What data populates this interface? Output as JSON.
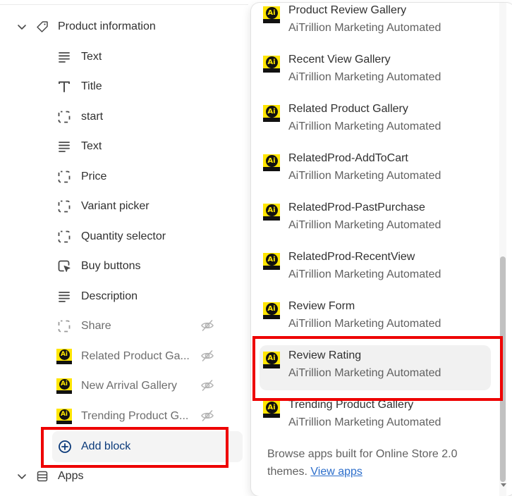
{
  "sidebar": {
    "section_title": "Product information",
    "blocks": [
      {
        "label": "Text",
        "icon": "text-lines-icon",
        "hidden": false
      },
      {
        "label": "Title",
        "icon": "title-t-icon",
        "hidden": false
      },
      {
        "label": "start",
        "icon": "dashed-block-icon",
        "hidden": false
      },
      {
        "label": "Text",
        "icon": "text-lines-icon",
        "hidden": false
      },
      {
        "label": "Price",
        "icon": "dashed-block-icon",
        "hidden": false
      },
      {
        "label": "Variant picker",
        "icon": "dashed-block-icon",
        "hidden": false
      },
      {
        "label": "Quantity selector",
        "icon": "dashed-block-icon",
        "hidden": false
      },
      {
        "label": "Buy buttons",
        "icon": "cursor-block-icon",
        "hidden": false
      },
      {
        "label": "Description",
        "icon": "text-lines-icon",
        "hidden": false
      },
      {
        "label": "Share",
        "icon": "dashed-block-icon",
        "hidden": true
      },
      {
        "label": "Related Product Ga...",
        "icon": "aitrillion-logo-icon",
        "hidden": true
      },
      {
        "label": "New Arrival Gallery",
        "icon": "aitrillion-logo-icon",
        "hidden": true
      },
      {
        "label": "Trending Product G...",
        "icon": "aitrillion-logo-icon",
        "hidden": true
      }
    ],
    "add_block_label": "Add block",
    "apps_section_title": "Apps"
  },
  "popover": {
    "apps": [
      {
        "name": "Product Review Gallery",
        "provider": "AiTrillion Marketing Automated"
      },
      {
        "name": "Recent View Gallery",
        "provider": "AiTrillion Marketing Automated"
      },
      {
        "name": "Related Product Gallery",
        "provider": "AiTrillion Marketing Automated"
      },
      {
        "name": "RelatedProd-AddToCart",
        "provider": "AiTrillion Marketing Automated"
      },
      {
        "name": "RelatedProd-PastPurchase",
        "provider": "AiTrillion Marketing Automated"
      },
      {
        "name": "RelatedProd-RecentView",
        "provider": "AiTrillion Marketing Automated"
      },
      {
        "name": "Review Form",
        "provider": "AiTrillion Marketing Automated"
      },
      {
        "name": "Review Rating",
        "provider": "AiTrillion Marketing Automated",
        "selected": true
      },
      {
        "name": "Trending Product Gallery",
        "provider": "AiTrillion Marketing Automated"
      }
    ],
    "browse_text": "Browse apps built for Online Store 2.0 themes.",
    "view_apps_link": "View apps",
    "logo_text": "Ai"
  },
  "colors": {
    "highlight_red": "#ee0000",
    "link_blue": "#2c6ecb",
    "add_block_blue": "#0b3a7a",
    "ai_logo_yellow": "#ffe500"
  }
}
